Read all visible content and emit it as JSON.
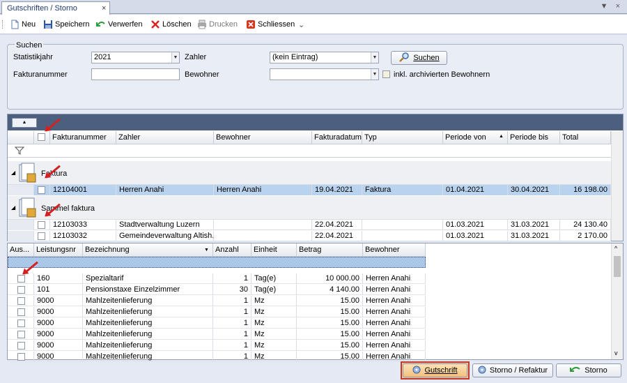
{
  "tab": {
    "title": "Gutschriften / Storno",
    "close": "×",
    "right_icons": "▼ ×"
  },
  "toolbar": {
    "new": "Neu",
    "save": "Speichern",
    "discard": "Verwerfen",
    "delete": "Löschen",
    "print": "Drucken",
    "close": "Schliessen",
    "more": "⌄"
  },
  "search": {
    "legend": "Suchen",
    "year_label": "Statistikjahr",
    "year_value": "2021",
    "payer_label": "Zahler",
    "payer_value": "(kein Eintrag)",
    "search_button": "Suchen",
    "invoice_label": "Fakturanummer",
    "invoice_value": "",
    "resident_label": "Bewohner",
    "resident_value": "",
    "archived_label": "inkl. archivierten Bewohnern"
  },
  "grid": {
    "columns": [
      "Fakturanummer",
      "Zahler",
      "Bewohner",
      "Fakturadatum",
      "Typ",
      "Periode von",
      "Periode bis",
      "Total"
    ],
    "groups": [
      {
        "label": "Faktura",
        "rows": [
          [
            "12104001",
            "Herren Anahi",
            "Herren Anahi",
            "19.04.2021",
            "Faktura",
            "01.04.2021",
            "30.04.2021",
            "16 198.00"
          ]
        ]
      },
      {
        "label": "Sammel faktura",
        "rows": [
          [
            "12103033",
            "Stadtverwaltung Luzern",
            "",
            "22.04.2021",
            "",
            "01.03.2021",
            "31.03.2021",
            "24 130.40"
          ],
          [
            "12103032",
            "Gemeindeverwaltung Altish...",
            "",
            "22.04.2021",
            "",
            "01.03.2021",
            "31.03.2021",
            "2 170.00"
          ]
        ]
      }
    ]
  },
  "detail": {
    "columns": [
      "Aus...",
      "Leistungsnr",
      "Bezeichnung",
      "Anzahl",
      "Einheit",
      "Betrag",
      "Bewohner"
    ],
    "rows": [
      [
        "160",
        "Spezialtarif",
        "1",
        "Tag(e)",
        "10 000.00",
        "Herren Anahi"
      ],
      [
        "101",
        "Pensionstaxe Einzelzimmer",
        "30",
        "Tag(e)",
        "4 140.00",
        "Herren Anahi"
      ],
      [
        "9000",
        "Mahlzeitenlieferung",
        "1",
        "Mz",
        "15.00",
        "Herren Anahi"
      ],
      [
        "9000",
        "Mahlzeitenlieferung",
        "1",
        "Mz",
        "15.00",
        "Herren Anahi"
      ],
      [
        "9000",
        "Mahlzeitenlieferung",
        "1",
        "Mz",
        "15.00",
        "Herren Anahi"
      ],
      [
        "9000",
        "Mahlzeitenlieferung",
        "1",
        "Mz",
        "15.00",
        "Herren Anahi"
      ],
      [
        "9000",
        "Mahlzeitenlieferung",
        "1",
        "Mz",
        "15.00",
        "Herren Anahi"
      ],
      [
        "9000",
        "Mahlzeitenlieferung",
        "1",
        "Mz",
        "15.00",
        "Herren Anahi"
      ]
    ]
  },
  "buttons": {
    "credit": "Gutschrift",
    "cancel_reinvoice": "Storno / Refaktur",
    "cancel": "Storno"
  },
  "colors": {
    "accent": "#1e3a6e",
    "selected": "#b9d3ee",
    "highlight_border": "#c0392b",
    "arrow": "#d42020"
  }
}
